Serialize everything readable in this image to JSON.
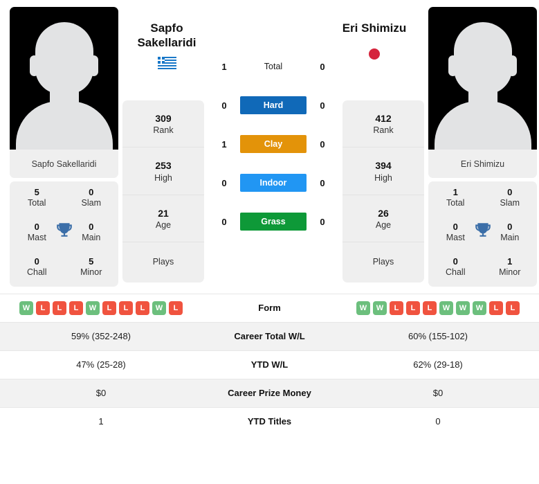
{
  "players": {
    "left": {
      "name": "Sapfo Sakellaridi",
      "name_line1": "Sapfo",
      "name_line2": "Sakellaridi",
      "flag_icon": "greece-flag-icon",
      "photo_alt": "player-photo-placeholder",
      "rank": "309",
      "rank_label": "Rank",
      "high": "253",
      "high_label": "High",
      "age": "21",
      "age_label": "Age",
      "plays": "",
      "plays_label": "Plays",
      "titles": {
        "total": "5",
        "total_label": "Total",
        "slam": "0",
        "slam_label": "Slam",
        "mast": "0",
        "mast_label": "Mast",
        "main": "0",
        "main_label": "Main",
        "chall": "0",
        "chall_label": "Chall",
        "minor": "5",
        "minor_label": "Minor"
      },
      "form": [
        "W",
        "L",
        "L",
        "L",
        "W",
        "L",
        "L",
        "L",
        "W",
        "L"
      ],
      "career_total_wl": "59% (352-248)",
      "ytd_wl": "47% (25-28)",
      "career_prize_money": "$0",
      "ytd_titles": "1"
    },
    "right": {
      "name": "Eri Shimizu",
      "name_line1": "Eri Shimizu",
      "name_line2": "",
      "flag_icon": "japan-flag-icon",
      "photo_alt": "player-photo-placeholder",
      "rank": "412",
      "rank_label": "Rank",
      "high": "394",
      "high_label": "High",
      "age": "26",
      "age_label": "Age",
      "plays": "",
      "plays_label": "Plays",
      "titles": {
        "total": "1",
        "total_label": "Total",
        "slam": "0",
        "slam_label": "Slam",
        "mast": "0",
        "mast_label": "Mast",
        "main": "0",
        "main_label": "Main",
        "chall": "0",
        "chall_label": "Chall",
        "minor": "1",
        "minor_label": "Minor"
      },
      "form": [
        "W",
        "W",
        "L",
        "L",
        "L",
        "W",
        "W",
        "W",
        "L",
        "L"
      ],
      "career_total_wl": "60% (155-102)",
      "ytd_wl": "62% (29-18)",
      "career_prize_money": "$0",
      "ytd_titles": "0"
    }
  },
  "head_to_head": [
    {
      "label": "Total",
      "left": "1",
      "right": "0",
      "style": "plain",
      "color": ""
    },
    {
      "label": "Hard",
      "left": "0",
      "right": "0",
      "style": "chip",
      "color": "#1069b8"
    },
    {
      "label": "Clay",
      "left": "1",
      "right": "0",
      "style": "chip",
      "color": "#e39309"
    },
    {
      "label": "Indoor",
      "left": "0",
      "right": "0",
      "style": "chip",
      "color": "#2196f3"
    },
    {
      "label": "Grass",
      "left": "0",
      "right": "0",
      "style": "chip",
      "color": "#0e9938"
    }
  ],
  "comparison_rows": [
    {
      "label": "Form",
      "left": "",
      "right": "",
      "type": "form",
      "shade": false
    },
    {
      "label": "Career Total W/L",
      "left": "59% (352-248)",
      "right": "60% (155-102)",
      "type": "text",
      "shade": true
    },
    {
      "label": "YTD W/L",
      "left": "47% (25-28)",
      "right": "62% (29-18)",
      "type": "text",
      "shade": false
    },
    {
      "label": "Career Prize Money",
      "left": "$0",
      "right": "$0",
      "type": "text",
      "shade": true
    },
    {
      "label": "YTD Titles",
      "left": "1",
      "right": "0",
      "type": "text",
      "shade": false
    }
  ],
  "colors": {
    "hard": "#1069b8",
    "clay": "#e39309",
    "indoor": "#2196f3",
    "grass": "#0e9938",
    "win_badge": "#6cbf7d",
    "loss_badge": "#f0533f",
    "trophy": "#3b6ea8",
    "card_bg": "#efefef"
  }
}
